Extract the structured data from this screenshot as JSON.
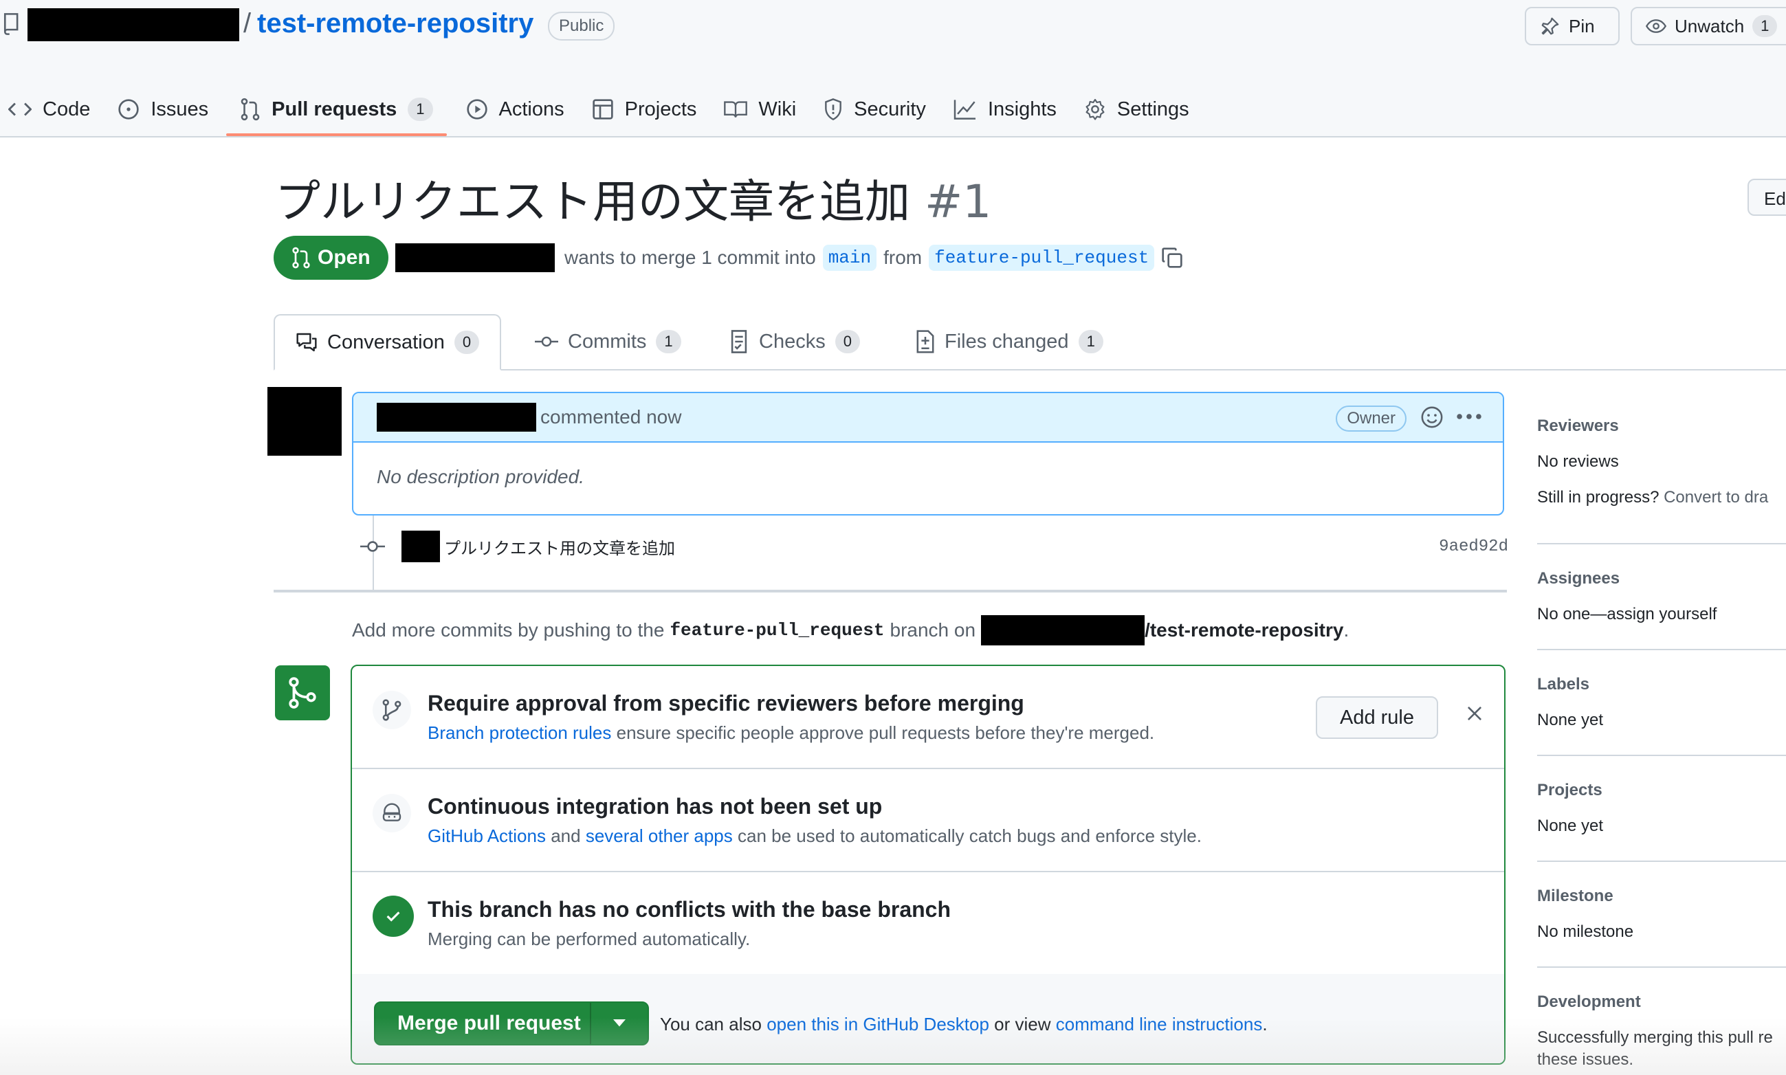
{
  "header": {
    "repo_name": "test-remote-repositry",
    "slash": "/",
    "visibility": "Public",
    "pin_label": "Pin",
    "unwatch_label": "Unwatch",
    "watch_count": "1"
  },
  "nav": {
    "items": [
      {
        "label": "Code"
      },
      {
        "label": "Issues"
      },
      {
        "label": "Pull requests",
        "count": "1"
      },
      {
        "label": "Actions"
      },
      {
        "label": "Projects"
      },
      {
        "label": "Wiki"
      },
      {
        "label": "Security"
      },
      {
        "label": "Insights"
      },
      {
        "label": "Settings"
      }
    ]
  },
  "pr": {
    "title": "プルリクエスト用の文章を追加",
    "number": "#1",
    "edit_label": "Ed",
    "state": "Open",
    "merge_text": "wants to merge 1 commit into",
    "base_branch": "main",
    "from_text": "from",
    "head_branch": "feature-pull_request"
  },
  "tabs": [
    {
      "label": "Conversation",
      "count": "0"
    },
    {
      "label": "Commits",
      "count": "1"
    },
    {
      "label": "Checks",
      "count": "0"
    },
    {
      "label": "Files changed",
      "count": "1"
    }
  ],
  "comment": {
    "action_text": "commented now",
    "role": "Owner",
    "body": "No description provided."
  },
  "commit": {
    "message": "プルリクエスト用の文章を追加",
    "sha": "9aed92d"
  },
  "push_note": {
    "prefix": "Add more commits by pushing to the",
    "branch": "feature-pull_request",
    "middle": "branch on",
    "repo": "/test-remote-repositry",
    "suffix": "."
  },
  "merge_box": {
    "rule_title": "Require approval from specific reviewers before merging",
    "rule_link": "Branch protection rules",
    "rule_desc": "ensure specific people approve pull requests before they're merged.",
    "add_rule_label": "Add rule",
    "ci_title": "Continuous integration has not been set up",
    "ci_link1": "GitHub Actions",
    "ci_and": "and",
    "ci_link2": "several other apps",
    "ci_desc": "can be used to automatically catch bugs and enforce style.",
    "conflict_title": "This branch has no conflicts with the base branch",
    "conflict_desc": "Merging can be performed automatically.",
    "merge_button": "Merge pull request",
    "hint_prefix": "You can also",
    "hint_link1": "open this in GitHub Desktop",
    "hint_middle": "or view",
    "hint_link2": "command line instructions",
    "hint_suffix": "."
  },
  "sidebar": {
    "reviewers": {
      "heading": "Reviewers",
      "value": "No reviews",
      "progress_q": "Still in progress?",
      "progress_link": "Convert to dra"
    },
    "assignees": {
      "heading": "Assignees",
      "value": "No one—assign yourself"
    },
    "labels": {
      "heading": "Labels",
      "value": "None yet"
    },
    "projects": {
      "heading": "Projects",
      "value": "None yet"
    },
    "milestone": {
      "heading": "Milestone",
      "value": "No milestone"
    },
    "development": {
      "heading": "Development",
      "value_line1": "Successfully merging this pull re",
      "value_line2": "these issues."
    }
  },
  "colors": {
    "accent": "#0969da",
    "success": "#1f883d",
    "nav_underline": "#fd8c73",
    "comment_header_bg": "#ddf4ff"
  }
}
